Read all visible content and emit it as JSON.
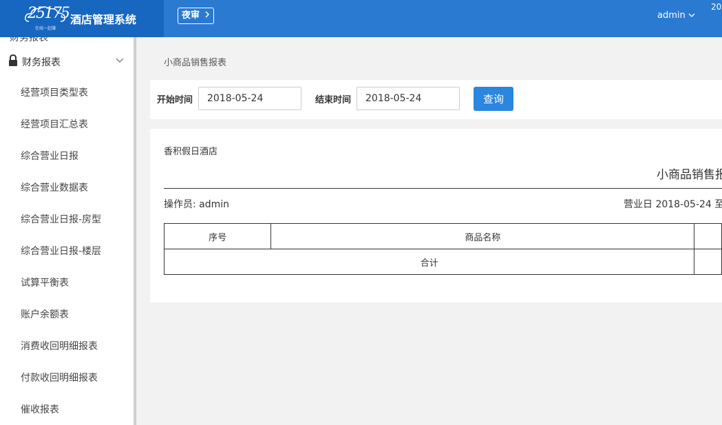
{
  "header": {
    "logo_text": "25175",
    "logo_tagline": "在线一起赚",
    "app_title": "酒店管理系统",
    "night_audit_label": "夜审",
    "user": "admin",
    "clipped_text": "20"
  },
  "sidebar": {
    "cut_off_item": "财务报表",
    "group_label": "财务报表",
    "items": [
      "经营项目类型表",
      "经营项目汇总表",
      "综合营业日报",
      "综合营业数据表",
      "综合营业日报-房型",
      "综合营业日报-楼层",
      "试算平衡表",
      "账户余额表",
      "消费收回明细报表",
      "付款收回明细报表",
      "催收报表"
    ]
  },
  "main": {
    "breadcrumb": "小商品销售报表",
    "filter": {
      "start_label": "开始时间",
      "start_value": "2018-05-24",
      "end_label": "结束时间",
      "end_value": "2018-05-24",
      "query_label": "查询"
    },
    "report": {
      "hotel_name": "香积假日酒店",
      "title": "小商品销售报",
      "operator": "操作员: admin",
      "business_date": "营业日 2018-05-24 至",
      "columns": [
        "序号",
        "商品名称"
      ],
      "total_label": "合计"
    }
  },
  "colors": {
    "header_bg": "#2a7ad2",
    "logo_bg": "#1766c0",
    "button_bg": "#2a86de"
  }
}
